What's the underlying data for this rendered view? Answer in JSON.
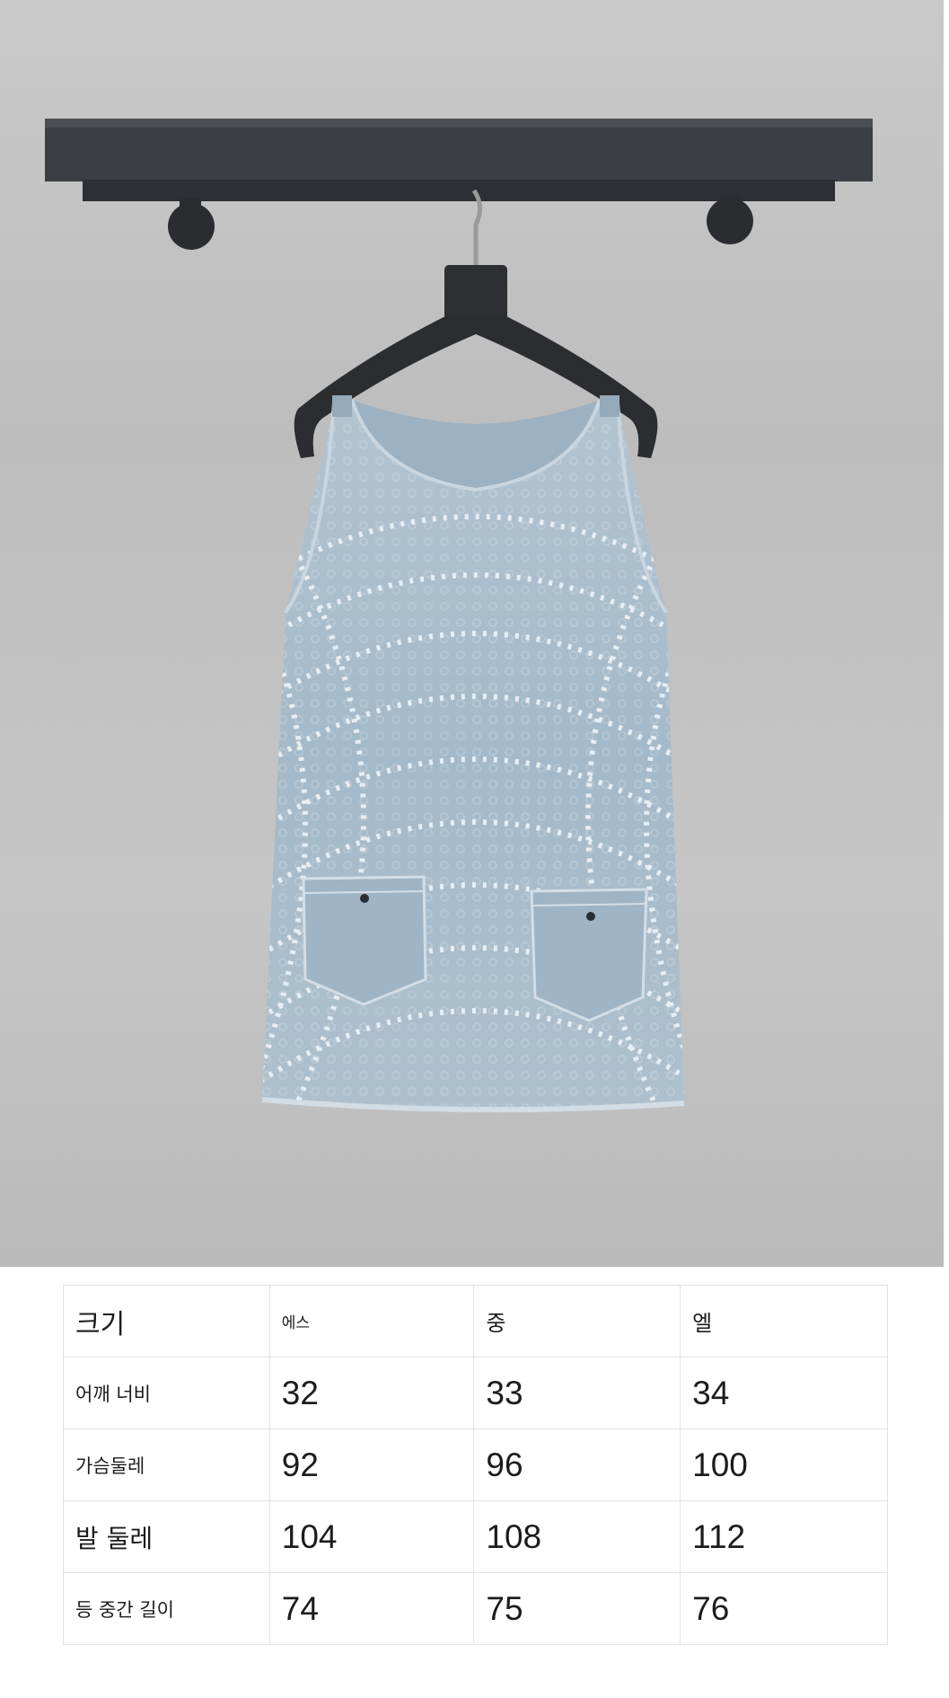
{
  "image": {
    "subject": "denim sleeveless mini dress on hanger",
    "colors": {
      "wall": "#c4c4c4",
      "shelf": "#3a3d40",
      "hanger": "#2b2d31",
      "denim": "#a9bccb",
      "denim_dark": "#8ea6b8",
      "pattern": "#e4ecf2"
    }
  },
  "size_table": {
    "header": {
      "label": "크기",
      "s": "에스",
      "m": "중",
      "l": "엘"
    },
    "rows": [
      {
        "label": "어깨 너비",
        "s": "32",
        "m": "33",
        "l": "34"
      },
      {
        "label": "가슴둘레",
        "s": "92",
        "m": "96",
        "l": "100"
      },
      {
        "label": "발 둘레",
        "s": "104",
        "m": "108",
        "l": "112"
      },
      {
        "label": "등 중간 길이",
        "s": "74",
        "m": "75",
        "l": "76"
      }
    ]
  }
}
